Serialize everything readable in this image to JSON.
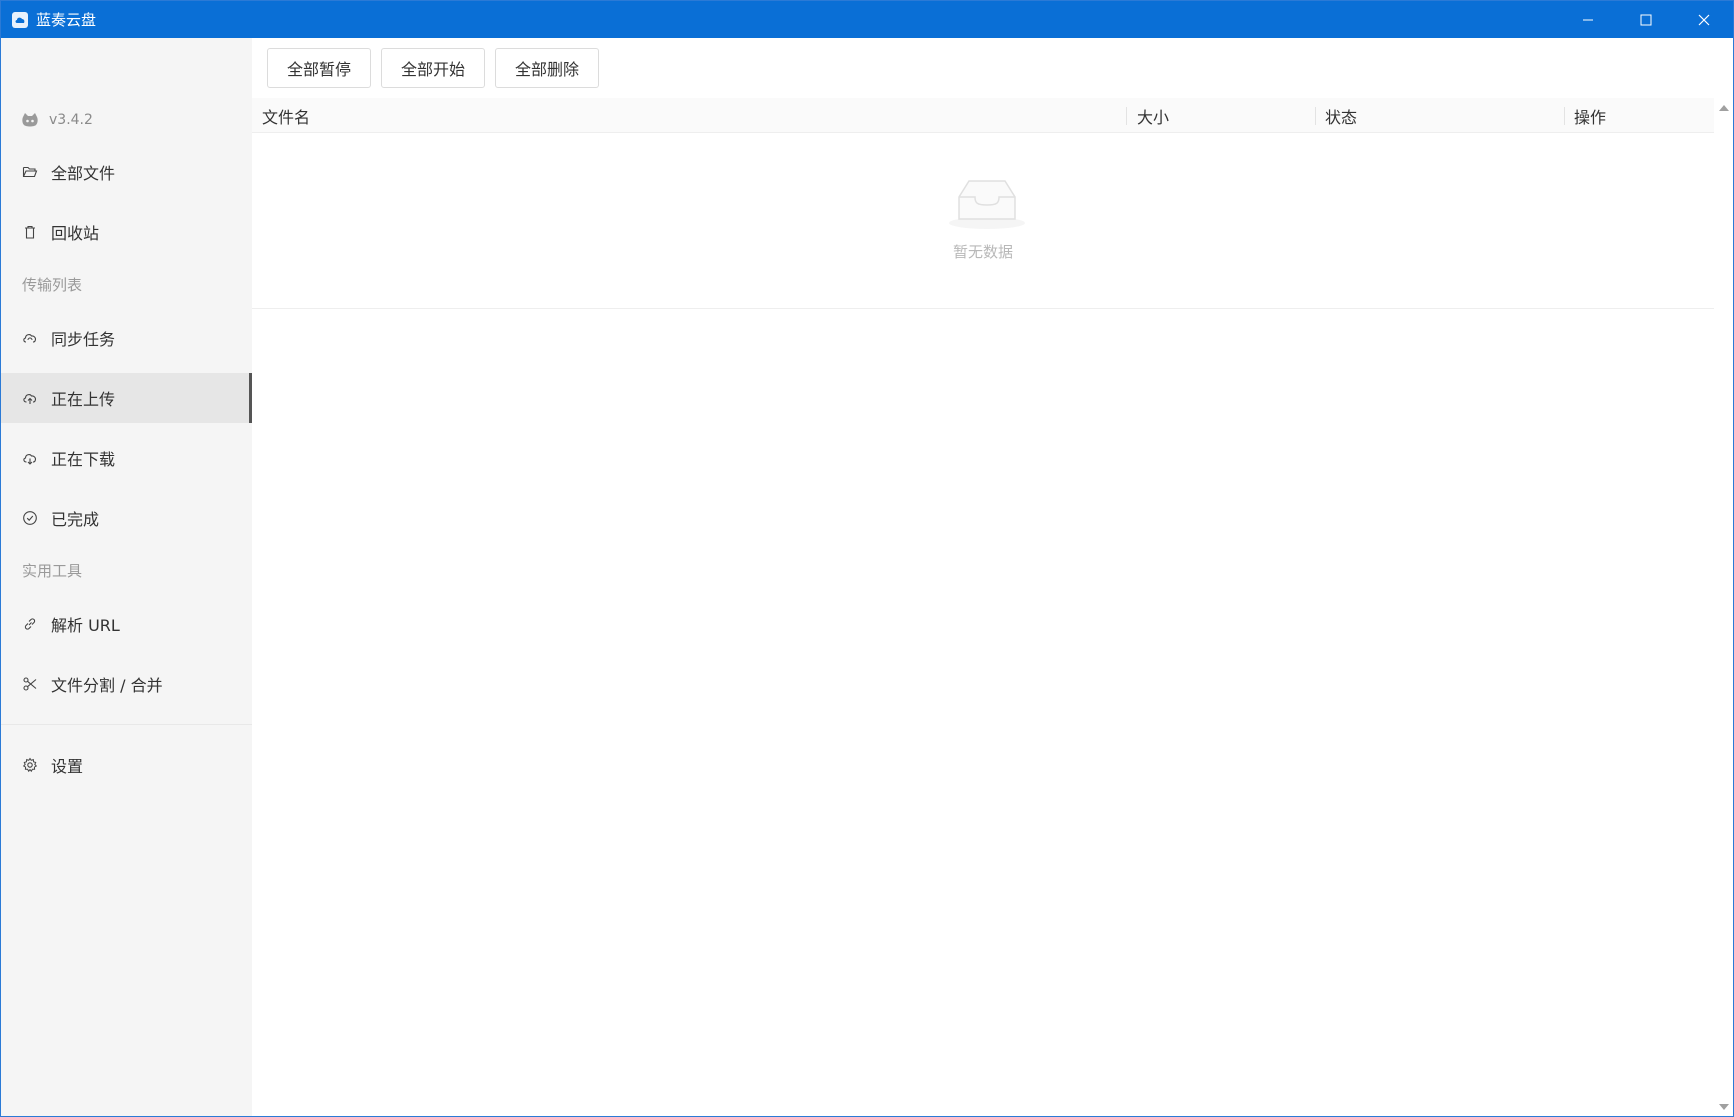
{
  "window": {
    "title": "蓝奏云盘",
    "colors": {
      "titlebar": "#0a6fd6",
      "sidebar": "#f5f5f5",
      "active": "#e6e6e6"
    }
  },
  "sidebar": {
    "version": "v3.4.2",
    "items": [
      {
        "label": "全部文件",
        "icon": "folder-open-icon"
      },
      {
        "label": "回收站",
        "icon": "trash-icon"
      },
      {
        "label": "同步任务",
        "icon": "cloud-sync-icon"
      },
      {
        "label": "正在上传",
        "icon": "cloud-upload-icon",
        "active": true
      },
      {
        "label": "正在下载",
        "icon": "cloud-download-icon"
      },
      {
        "label": "已完成",
        "icon": "check-circle-icon"
      },
      {
        "label": "解析 URL",
        "icon": "link-icon"
      },
      {
        "label": "文件分割 / 合并",
        "icon": "scissors-icon"
      },
      {
        "label": "设置",
        "icon": "gear-icon"
      }
    ],
    "groups": {
      "transfer": "传输列表",
      "tools": "实用工具"
    }
  },
  "toolbar": {
    "pause_all": "全部暂停",
    "start_all": "全部开始",
    "delete_all": "全部删除"
  },
  "table": {
    "columns": [
      "文件名",
      "大小",
      "状态",
      "操作"
    ],
    "empty_text": "暂无数据"
  }
}
